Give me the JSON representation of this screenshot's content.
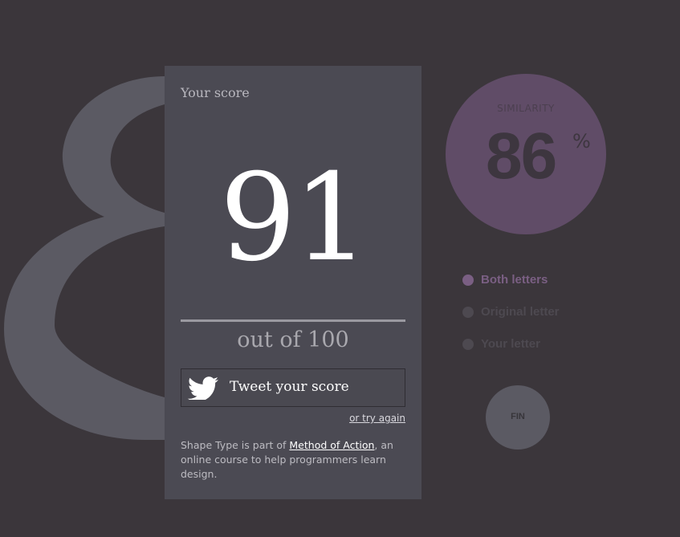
{
  "colors": {
    "background": "#3b363b",
    "card": "#4b4a53",
    "glyph": "#5b5a63",
    "accent": "#604c67",
    "accent_light": "#7a5f83"
  },
  "glyph_icon": "large-numeral-8",
  "card": {
    "label": "Your score",
    "score": "91",
    "out_of": "out of 100",
    "tweet_label": "Tweet your score",
    "tweet_icon": "twitter-bird-icon",
    "try_again": "or try again",
    "footer": {
      "prefix": "Shape Type is part of ",
      "link": "Method of Action",
      "suffix": ", an online course to help programmers learn design."
    }
  },
  "similarity": {
    "label": "SIMILARITY",
    "value": "86",
    "unit": "%"
  },
  "view_options": [
    {
      "label": "Both letters",
      "active": true
    },
    {
      "label": "Original letter",
      "active": false
    },
    {
      "label": "Your letter",
      "active": false
    }
  ],
  "fin_button": {
    "label": "FIN"
  }
}
